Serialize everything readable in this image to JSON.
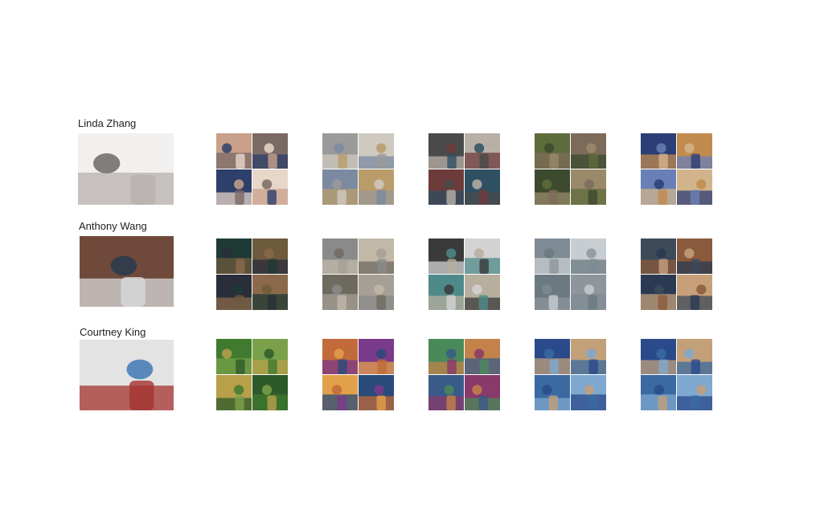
{
  "rows": [
    {
      "name": "Linda Zhang",
      "palette": [
        "#b7b2ae",
        "#f2f0ee",
        "#6c6866"
      ],
      "grids": [
        [
          "#c9a089",
          "#7a6a65",
          "#2d3f6a",
          "#e8d6c9"
        ],
        [
          "#9a9a9a",
          "#cfcabf",
          "#7b8aa0",
          "#b99c6a"
        ],
        [
          "#4a4a4a",
          "#b8b0a7",
          "#6e3b3b",
          "#2f4f63"
        ],
        [
          "#5e6b3b",
          "#7d6b5a",
          "#3c4a2e",
          "#9a8a6a"
        ],
        [
          "#2c3e75",
          "#c28b4d",
          "#6a7fb5",
          "#d2b48c"
        ]
      ]
    },
    {
      "name": "Anthony Wang",
      "palette": [
        "#d8dadb",
        "#6f4a3a",
        "#2a3a4e"
      ],
      "grids": [
        [
          "#1f3a35",
          "#6e5a3c",
          "#2a2e3a",
          "#8a6a4a"
        ],
        [
          "#8a8a8a",
          "#c2b8a8",
          "#6f6a60",
          "#a59f95"
        ],
        [
          "#3a3a3a",
          "#d3d3d3",
          "#4f8a8a",
          "#b7ae9e"
        ],
        [
          "#7f8b94",
          "#c8cdd2",
          "#6a7a80",
          "#8e969b"
        ],
        [
          "#3d4a5a",
          "#8a5a3c",
          "#2b3a52",
          "#c7a07a"
        ]
      ]
    },
    {
      "name": "Courtney King",
      "palette": [
        "#a4332f",
        "#e3e3e3",
        "#3f78b5"
      ],
      "grids": [
        [
          "#3f7a2e",
          "#7aa14a",
          "#b8a04a",
          "#2e5a2a"
        ],
        [
          "#c26a3a",
          "#7a3a8a",
          "#e3a04a",
          "#2a4a7a"
        ],
        [
          "#4a8a5a",
          "#c2824a",
          "#3a5a8a",
          "#8a3a6a"
        ],
        [
          "#2a4a8a",
          "#c2a07a",
          "#3a6aa0",
          "#7fa8d0"
        ],
        [
          "#2a4a8a",
          "#c2a07a",
          "#3a6aa0",
          "#7fa8d0"
        ]
      ]
    }
  ]
}
